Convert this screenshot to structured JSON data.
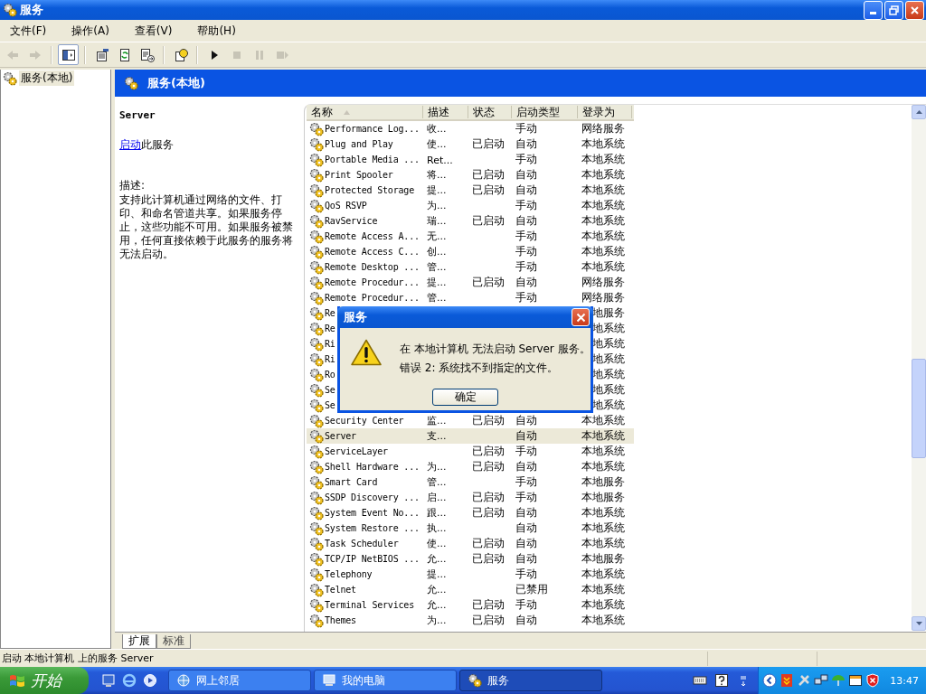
{
  "window": {
    "title": "服务"
  },
  "menu": [
    {
      "label": "文件(F)"
    },
    {
      "label": "操作(A)"
    },
    {
      "label": "查看(V)"
    },
    {
      "label": "帮助(H)"
    }
  ],
  "toolbar": [
    {
      "kind": "back",
      "disabled": true
    },
    {
      "kind": "forward",
      "disabled": true
    },
    {
      "kind": "sep"
    },
    {
      "kind": "tree",
      "disabled": false,
      "pressed": true
    },
    {
      "kind": "sep"
    },
    {
      "kind": "properties",
      "disabled": false
    },
    {
      "kind": "refresh",
      "disabled": false
    },
    {
      "kind": "export",
      "disabled": false
    },
    {
      "kind": "sep"
    },
    {
      "kind": "help",
      "disabled": false
    },
    {
      "kind": "sep"
    },
    {
      "kind": "start",
      "disabled": false
    },
    {
      "kind": "stop",
      "disabled": true
    },
    {
      "kind": "pause",
      "disabled": true
    },
    {
      "kind": "restart",
      "disabled": true
    }
  ],
  "tree": [
    {
      "label": "服务(本地)",
      "selected": true
    }
  ],
  "pane_header": "服务(本地)",
  "detail": {
    "title": "Server",
    "link": "启动",
    "link_suffix": "此服务",
    "desc_label": "描述:",
    "description": "支持此计算机通过网络的文件、打印、和命名管道共享。如果服务停止，这些功能不可用。如果服务被禁用，任何直接依赖于此服务的服务将无法启动。"
  },
  "table": {
    "columns": [
      {
        "label": "名称",
        "sorted": true
      },
      {
        "label": "描述",
        "sorted": false
      },
      {
        "label": "状态",
        "sorted": false
      },
      {
        "label": "启动类型",
        "sorted": false
      },
      {
        "label": "登录为",
        "sorted": false
      }
    ],
    "rows": [
      {
        "name": "Performance Log...",
        "desc": "收...",
        "type": "手动",
        "logon": "网络服务",
        "selected": false
      },
      {
        "name": "Plug and Play",
        "desc": "使...",
        "status": "已启动",
        "type": "自动",
        "logon": "本地系统",
        "selected": false
      },
      {
        "name": "Portable Media ...",
        "desc": "Ret...",
        "type": "手动",
        "logon": "本地系统",
        "selected": false
      },
      {
        "name": "Print Spooler",
        "desc": "将...",
        "status": "已启动",
        "type": "自动",
        "logon": "本地系统",
        "selected": false
      },
      {
        "name": "Protected Storage",
        "desc": "提...",
        "status": "已启动",
        "type": "自动",
        "logon": "本地系统",
        "selected": false
      },
      {
        "name": "QoS RSVP",
        "desc": "为...",
        "type": "手动",
        "logon": "本地系统",
        "selected": false
      },
      {
        "name": "RavService",
        "desc": "瑞...",
        "status": "已启动",
        "type": "自动",
        "logon": "本地系统",
        "selected": false
      },
      {
        "name": "Remote Access A...",
        "desc": "无...",
        "type": "手动",
        "logon": "本地系统",
        "selected": false
      },
      {
        "name": "Remote Access C...",
        "desc": "创...",
        "type": "手动",
        "logon": "本地系统",
        "selected": false
      },
      {
        "name": "Remote Desktop ...",
        "desc": "管...",
        "type": "手动",
        "logon": "本地系统",
        "selected": false
      },
      {
        "name": "Remote Procedur...",
        "desc": "提...",
        "status": "已启动",
        "type": "自动",
        "logon": "网络服务",
        "selected": false
      },
      {
        "name": "Remote Procedur...",
        "desc": "管...",
        "type": "手动",
        "logon": "网络服务",
        "selected": false
      },
      {
        "name": "Re",
        "logon": "地服务",
        "selected": false
      },
      {
        "name": "Re",
        "logon": "地系统",
        "selected": false
      },
      {
        "name": "Ri",
        "logon": "地系统",
        "selected": false
      },
      {
        "name": "Ri",
        "logon": "地系统",
        "selected": false
      },
      {
        "name": "Ro",
        "logon": "地系统",
        "selected": false
      },
      {
        "name": "Se",
        "logon": "地系统",
        "selected": false
      },
      {
        "name": "Se",
        "logon": "地系统",
        "selected": false
      },
      {
        "name": "Security Center",
        "desc": "监...",
        "status": "已启动",
        "type": "自动",
        "logon": "本地系统",
        "selected": false
      },
      {
        "name": "Server",
        "desc": "支...",
        "type": "自动",
        "logon": "本地系统",
        "selected": true
      },
      {
        "name": "ServiceLayer",
        "status": "已启动",
        "type": "手动",
        "logon": "本地系统",
        "selected": false
      },
      {
        "name": "Shell Hardware ...",
        "desc": "为...",
        "status": "已启动",
        "type": "自动",
        "logon": "本地系统",
        "selected": false
      },
      {
        "name": "Smart Card",
        "desc": "管...",
        "type": "手动",
        "logon": "本地服务",
        "selected": false
      },
      {
        "name": "SSDP Discovery ...",
        "desc": "启...",
        "status": "已启动",
        "type": "手动",
        "logon": "本地服务",
        "selected": false
      },
      {
        "name": "System Event No...",
        "desc": "跟...",
        "status": "已启动",
        "type": "自动",
        "logon": "本地系统",
        "selected": false
      },
      {
        "name": "System Restore ...",
        "desc": "执...",
        "type": "自动",
        "logon": "本地系统",
        "selected": false
      },
      {
        "name": "Task Scheduler",
        "desc": "使...",
        "status": "已启动",
        "type": "自动",
        "logon": "本地系统",
        "selected": false
      },
      {
        "name": "TCP/IP NetBIOS ...",
        "desc": "允...",
        "status": "已启动",
        "type": "自动",
        "logon": "本地服务",
        "selected": false
      },
      {
        "name": "Telephony",
        "desc": "提...",
        "type": "手动",
        "logon": "本地系统",
        "selected": false
      },
      {
        "name": "Telnet",
        "desc": "允...",
        "type": "已禁用",
        "logon": "本地系统",
        "selected": false
      },
      {
        "name": "Terminal Services",
        "desc": "允...",
        "status": "已启动",
        "type": "手动",
        "logon": "本地系统",
        "selected": false
      },
      {
        "name": "Themes",
        "desc": "为...",
        "status": "已启动",
        "type": "自动",
        "logon": "本地系统",
        "selected": false
      }
    ]
  },
  "tabs": [
    {
      "label": "扩展",
      "selected": true
    },
    {
      "label": "标准",
      "selected": false
    }
  ],
  "status_bar": "启动 本地计算机 上的服务 Server",
  "dialog": {
    "title": "服务",
    "message": "在 本地计算机 无法启动 Server 服务。",
    "error": "错误 2: 系统找不到指定的文件。",
    "button": "确定"
  },
  "taskbar": {
    "start": "开始",
    "tasks": [
      {
        "label": "网上邻居",
        "selected": false
      },
      {
        "label": "我的电脑",
        "selected": false
      },
      {
        "label": "服务",
        "selected": true
      }
    ],
    "clock": "13:47"
  }
}
